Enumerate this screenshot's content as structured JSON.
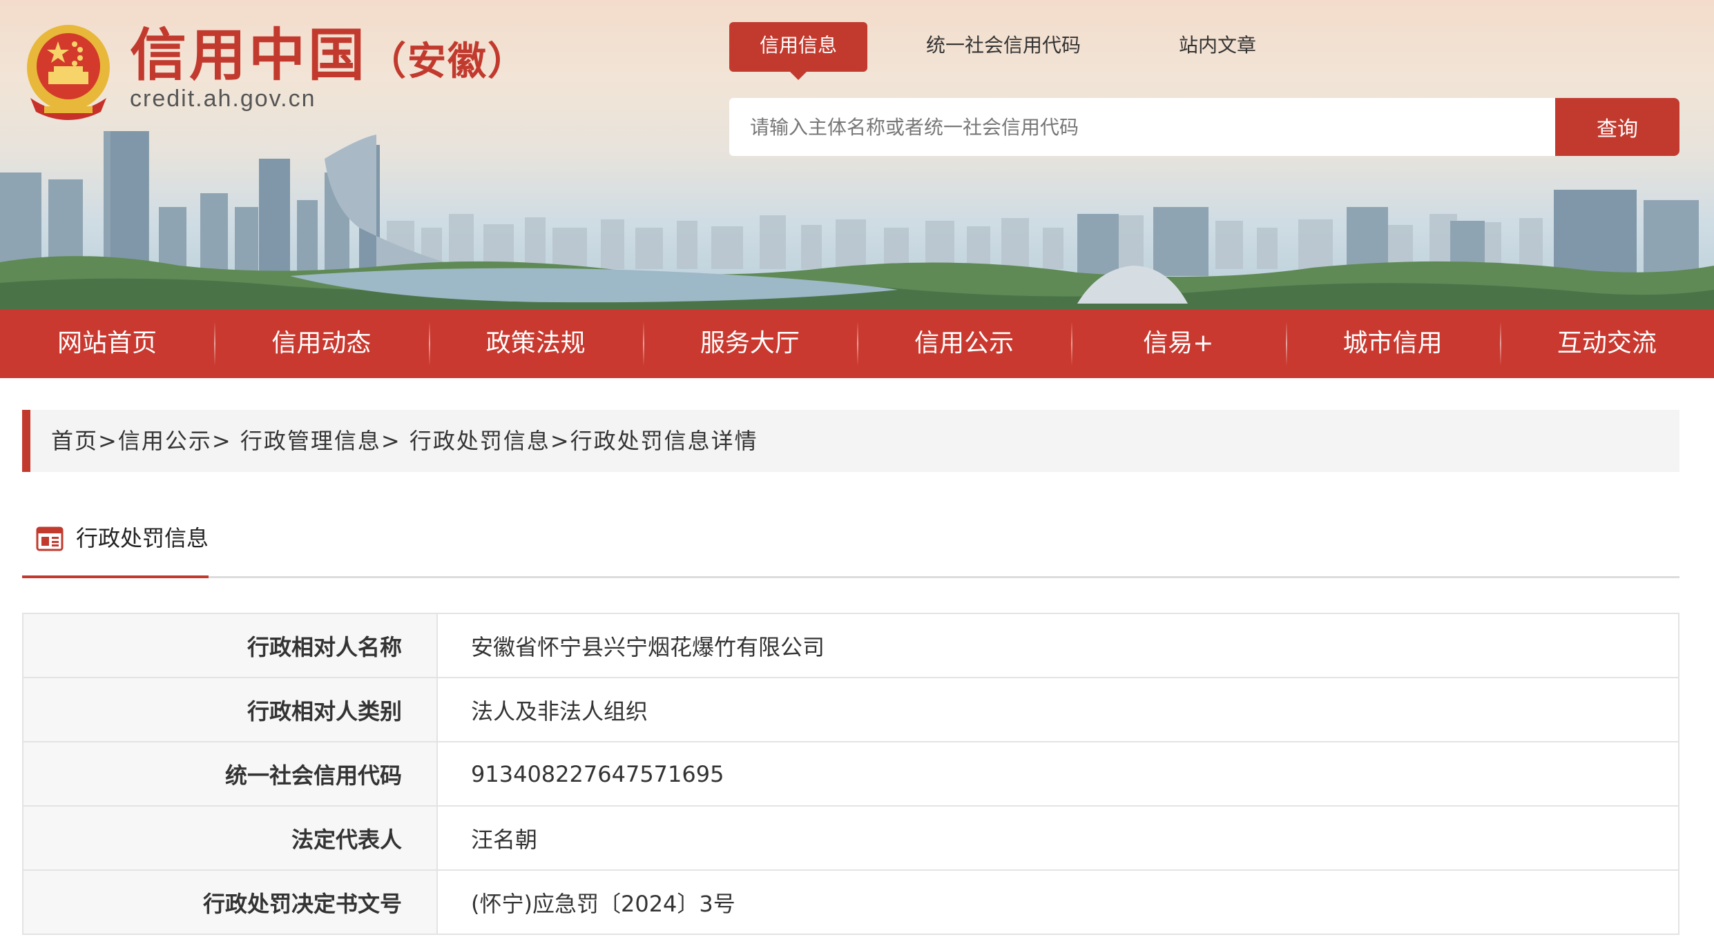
{
  "site": {
    "title": "信用中国",
    "subtitle": "（安徽）",
    "domain": "credit.ah.gov.cn"
  },
  "search": {
    "tabs": [
      {
        "label": "信用信息",
        "active": true
      },
      {
        "label": "统一社会信用代码",
        "active": false
      },
      {
        "label": "站内文章",
        "active": false
      }
    ],
    "placeholder": "请输入主体名称或者统一社会信用代码",
    "button_label": "查询"
  },
  "nav": {
    "items": [
      "网站首页",
      "信用动态",
      "政策法规",
      "服务大厅",
      "信用公示",
      "信易+",
      "城市信用",
      "互动交流"
    ]
  },
  "breadcrumb": {
    "items": [
      "首页",
      "信用公示",
      "行政管理信息",
      "行政处罚信息",
      "行政处罚信息详情"
    ],
    "separators": [
      ">",
      "> ",
      "> ",
      ">"
    ]
  },
  "section": {
    "title": "行政处罚信息"
  },
  "table": {
    "rows": [
      {
        "label": "行政相对人名称",
        "value": "安徽省怀宁县兴宁烟花爆竹有限公司"
      },
      {
        "label": "行政相对人类别",
        "value": "法人及非法人组织"
      },
      {
        "label": "统一社会信用代码",
        "value": "913408227647571695"
      },
      {
        "label": "法定代表人",
        "value": "汪名朝"
      },
      {
        "label": "行政处罚决定书文号",
        "value": "(怀宁)应急罚〔2024〕3号"
      }
    ]
  },
  "colors": {
    "brand_red": "#c23a2e",
    "nav_red": "#c9392f",
    "emblem_gold": "#e8b83a"
  }
}
